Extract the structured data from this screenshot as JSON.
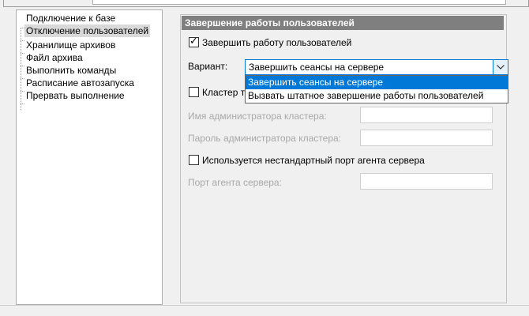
{
  "tree": {
    "items": [
      {
        "label": "Подключение к базе",
        "selected": false
      },
      {
        "label": "Отключение пользователей",
        "selected": true
      },
      {
        "label": "Хранилище архивов",
        "selected": false
      },
      {
        "label": "Файл архива",
        "selected": false
      },
      {
        "label": "Выполнить команды",
        "selected": false
      },
      {
        "label": "Расписание автозапуска",
        "selected": false
      },
      {
        "label": "Прервать выполнение",
        "selected": false
      }
    ]
  },
  "section": {
    "title": "Завершение работы пользователей"
  },
  "form": {
    "terminate_users": {
      "label": "Завершить работу пользователей",
      "checked": true
    },
    "variant_label": "Вариант:",
    "variant_value": "Завершить сеансы на сервере",
    "variant_options": [
      "Завершить сеансы на сервере",
      "Вызвать штатное завершение работы пользователей"
    ],
    "cluster_check": {
      "label": "Кластер т",
      "checked": false
    },
    "cluster_admin_name_label": "Имя администратора кластера:",
    "cluster_admin_password_label": "Пароль администратора кластера:",
    "nonstandard_port": {
      "label": "Используется нестандартный порт агента сервера",
      "checked": false
    },
    "agent_port_label": "Порт агента сервера:"
  },
  "colors": {
    "accent": "#0078d7",
    "section_header": "#7f7f7f",
    "disabled_text": "#a8a8a8"
  }
}
